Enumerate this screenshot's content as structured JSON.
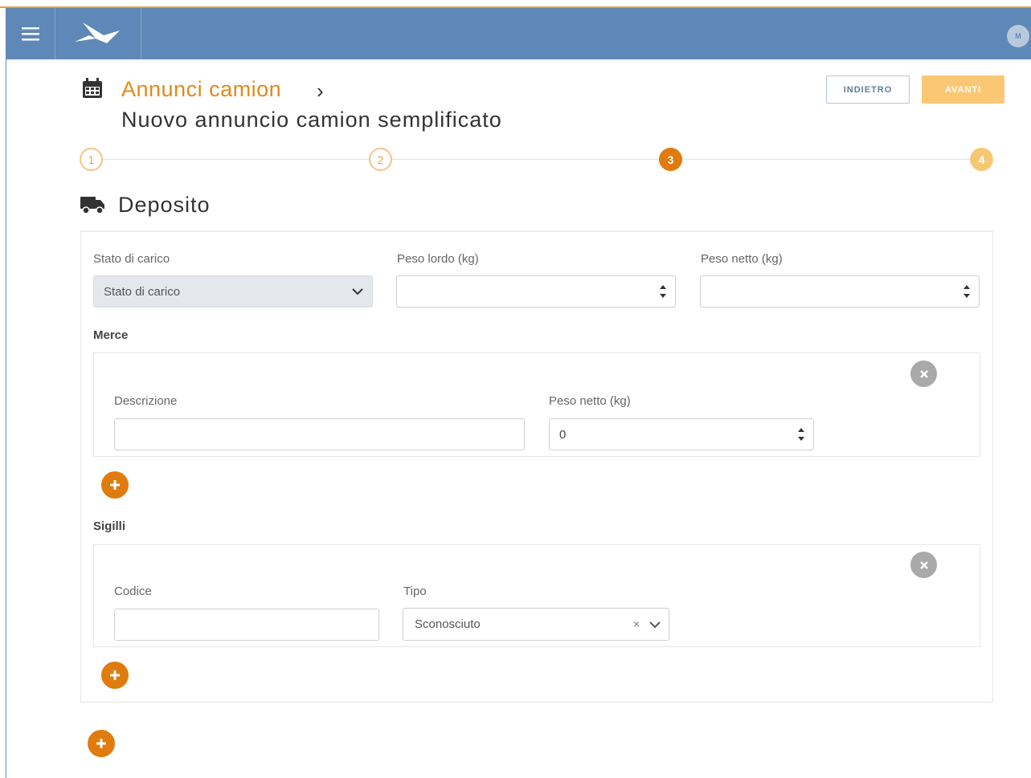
{
  "header": {
    "menu_icon": "hamburger-icon",
    "logo_icon": "bird-logo-icon",
    "avatar_text": "M"
  },
  "breadcrumb": {
    "parent_label": "Annunci camion",
    "separator": "›",
    "title": "Nuovo annuncio camion semplificato"
  },
  "actions": {
    "back_label": "INDIETRO",
    "next_label": "AVANTI"
  },
  "stepper": {
    "steps": [
      "1",
      "2",
      "3",
      "4"
    ],
    "current": 3
  },
  "section": {
    "title": "Deposito",
    "icon": "truck-icon"
  },
  "form": {
    "stato_label": "Stato di carico",
    "stato_value": "Stato di carico",
    "peso_lordo_label": "Peso lordo (kg)",
    "peso_netto_label": "Peso netto (kg)",
    "merce": {
      "label": "Merce",
      "descrizione_label": "Descrizione",
      "peso_netto_label": "Peso netto (kg)",
      "peso_netto_value": "0"
    },
    "sigilli": {
      "label": "Sigilli",
      "codice_label": "Codice",
      "tipo_label": "Tipo",
      "tipo_value": "Sconosciuto",
      "clear_symbol": "×"
    }
  },
  "colors": {
    "navbar": "#5e88b7",
    "accent": "#e07b0e",
    "accent_light": "#fac875"
  }
}
